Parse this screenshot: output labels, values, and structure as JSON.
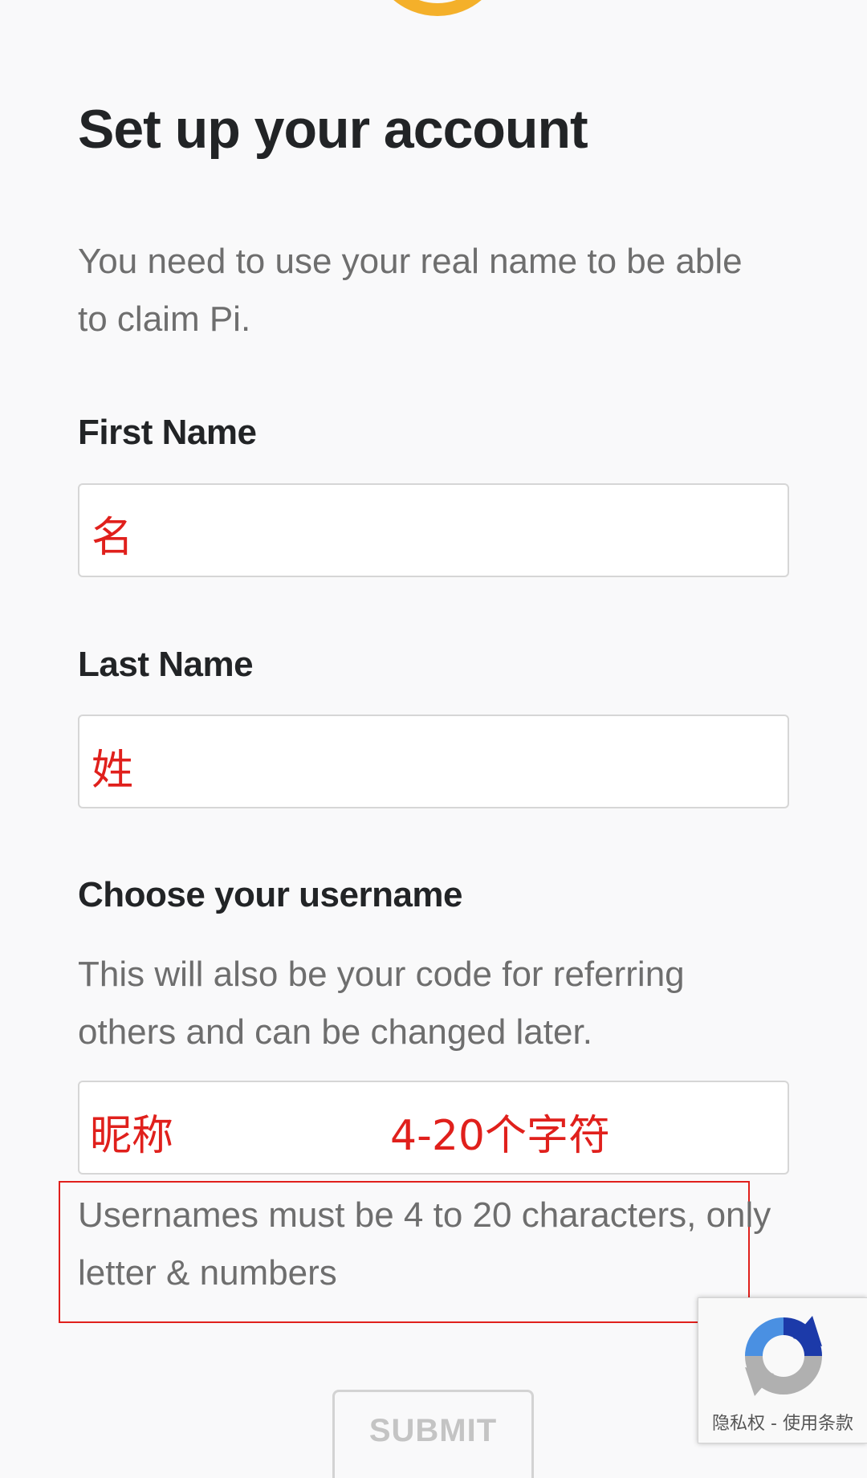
{
  "page": {
    "title": "Set up your account",
    "intro": "You need to use your real name to be able to claim Pi."
  },
  "first_name": {
    "label": "First Name",
    "value": "",
    "annotation": "名"
  },
  "last_name": {
    "label": "Last Name",
    "value": "",
    "annotation": "姓"
  },
  "username": {
    "label": "Choose your username",
    "description": "This will also be your code for referring others and can be changed later.",
    "value": "",
    "annotation_left": "昵称",
    "annotation_right": "4-20个字符",
    "hint": "Usernames must be 4 to 20 characters, only letter & numbers"
  },
  "submit": {
    "label": "SUBMIT"
  },
  "recaptcha": {
    "icon": "recaptcha-icon",
    "links": "隐私权 - 使用条款"
  },
  "colors": {
    "logo_accent": "#f4b02a",
    "annotation_red": "#e0201c",
    "text_dark": "#222426",
    "text_muted": "#6e6e6e",
    "recaptcha_blue": "#1c3aa9",
    "recaptcha_light_blue": "#4a90e2",
    "recaptcha_gray": "#b0b0b0"
  }
}
